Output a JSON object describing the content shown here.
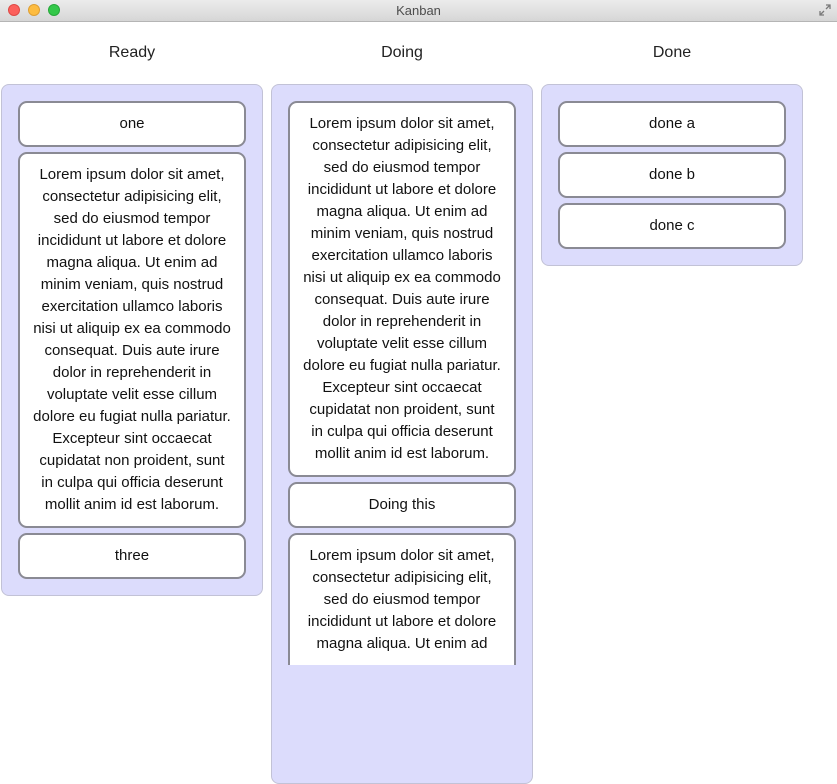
{
  "window": {
    "title": "Kanban"
  },
  "columns": [
    {
      "header": "Ready",
      "cards": [
        {
          "text": "one"
        },
        {
          "text": "Lorem ipsum dolor sit amet, consectetur adipisicing elit, sed do eiusmod tempor incididunt ut labore et dolore magna aliqua. Ut enim ad minim veniam, quis nostrud exercitation ullamco laboris nisi ut aliquip ex ea commodo consequat. Duis aute irure dolor in reprehenderit in voluptate velit esse cillum dolore eu fugiat nulla pariatur. Excepteur sint occaecat cupidatat non proident, sunt in culpa qui officia deserunt mollit anim id est laborum."
        },
        {
          "text": "three"
        }
      ]
    },
    {
      "header": "Doing",
      "cards": [
        {
          "text": "Lorem ipsum dolor sit amet, consectetur adipisicing elit, sed do eiusmod tempor incididunt ut labore et dolore magna aliqua. Ut enim ad minim veniam, quis nostrud exercitation ullamco laboris nisi ut aliquip ex ea commodo consequat. Duis aute irure dolor in reprehenderit in voluptate velit esse cillum dolore eu fugiat nulla pariatur. Excepteur sint occaecat cupidatat non proident, sunt in culpa qui officia deserunt mollit anim id est laborum."
        },
        {
          "text": "Doing this"
        },
        {
          "text": "Lorem ipsum dolor sit amet, consectetur adipisicing elit, sed do eiusmod tempor incididunt ut labore et dolore magna aliqua. Ut enim ad"
        }
      ]
    },
    {
      "header": "Done",
      "cards": [
        {
          "text": "done a"
        },
        {
          "text": "done b"
        },
        {
          "text": "done c"
        }
      ]
    }
  ],
  "icons": {
    "close": "close-icon",
    "minimize": "minimize-icon",
    "zoom": "zoom-icon",
    "fullscreen": "fullscreen-icon"
  },
  "colors": {
    "column_bg": "#dcdcfc",
    "card_border": "#8a8a94",
    "close": "#fc605c",
    "minimize": "#fdbc40",
    "zoom": "#34c84a"
  }
}
